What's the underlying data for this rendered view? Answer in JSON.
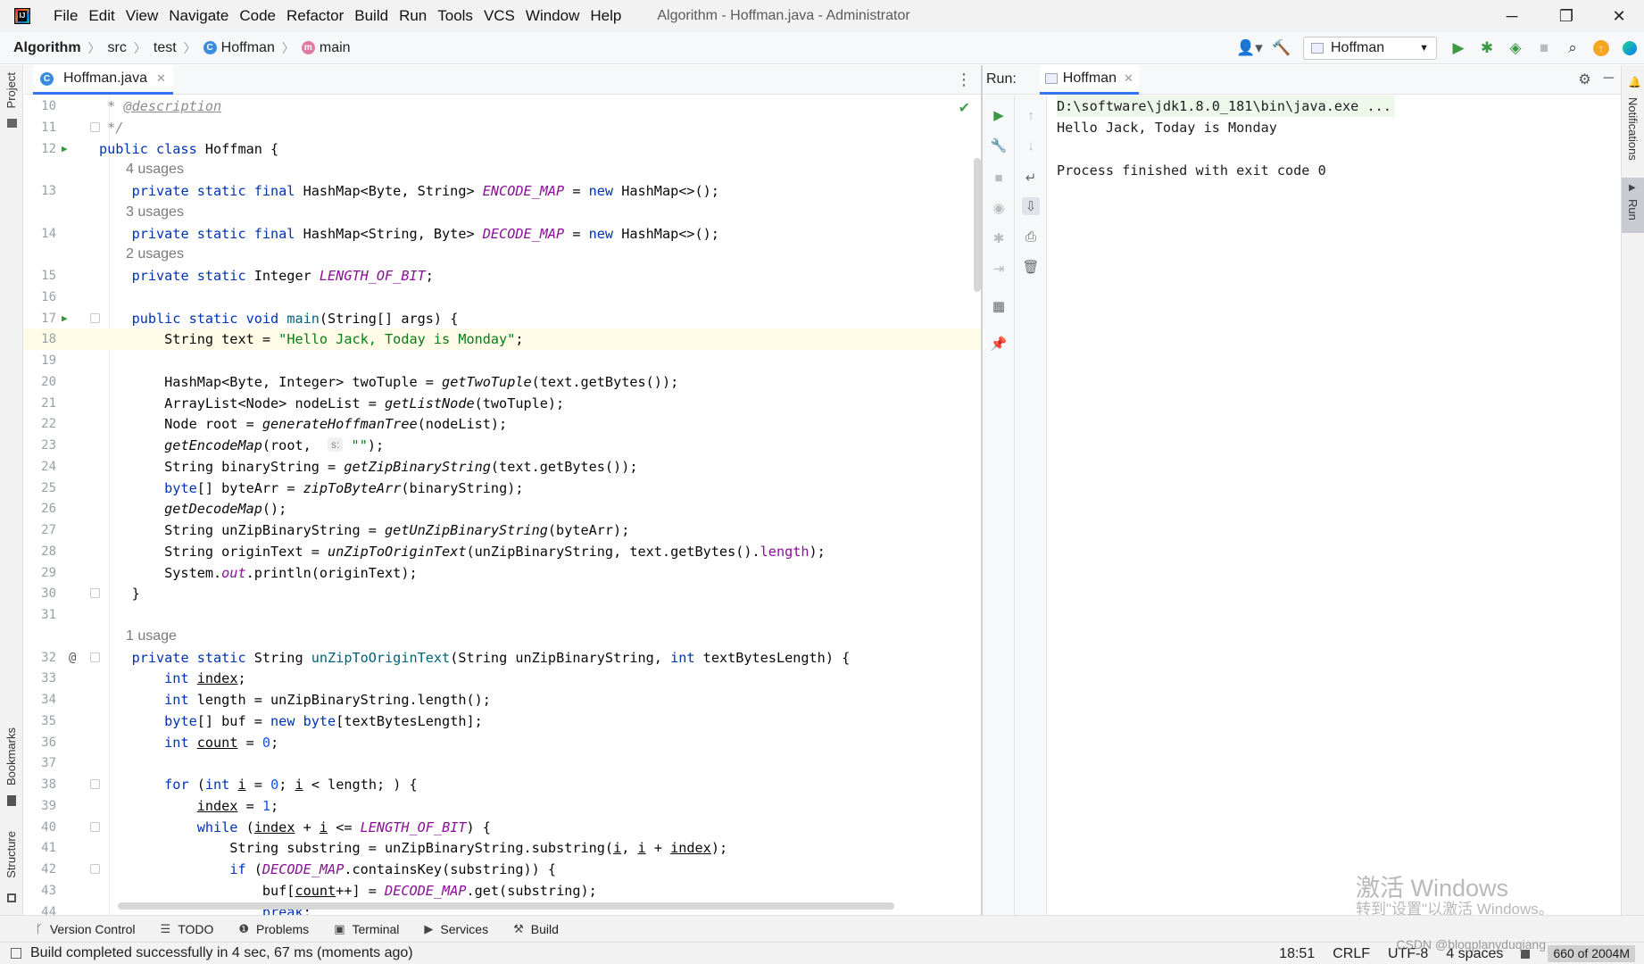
{
  "window": {
    "menu": [
      "File",
      "Edit",
      "View",
      "Navigate",
      "Code",
      "Refactor",
      "Build",
      "Run",
      "Tools",
      "VCS",
      "Window",
      "Help"
    ],
    "title": "Algorithm - Hoffman.java - Administrator",
    "controls": {
      "minimize": "─",
      "restore": "❐",
      "close": "✕"
    }
  },
  "breadcrumb": {
    "project": "Algorithm",
    "items": [
      "src",
      "test"
    ],
    "class_name": "Hoffman",
    "method_name": "main"
  },
  "toolbar": {
    "run_config": "Hoffman"
  },
  "left_strip": {
    "project": "Project",
    "bookmarks": "Bookmarks",
    "structure": "Structure"
  },
  "right_strip": {
    "notifications": "Notifications",
    "run": "Run"
  },
  "editor": {
    "tab": "Hoffman.java",
    "lines": [
      {
        "n": "10",
        "html": "<span class=\"com\"> * </span><span class=\"ann\">@description</span>"
      },
      {
        "n": "11",
        "html": "<span class=\"com\"> */</span>"
      },
      {
        "n": "12",
        "html": "<span class=\"kw\">public class</span> Hoffman {"
      },
      {
        "hint": "4 usages"
      },
      {
        "n": "13",
        "html": "    <span class=\"kw\">private static final</span> HashMap&lt;Byte, String&gt; <span class=\"fld\">ENCODE_MAP</span> = <span class=\"kw\">new</span> HashMap&lt;&gt;();"
      },
      {
        "hint": "3 usages"
      },
      {
        "n": "14",
        "html": "    <span class=\"kw\">private static final</span> HashMap&lt;String, Byte&gt; <span class=\"fld\">DECODE_MAP</span> = <span class=\"kw\">new</span> HashMap&lt;&gt;();"
      },
      {
        "hint": "2 usages"
      },
      {
        "n": "15",
        "html": "    <span class=\"kw\">private static</span> Integer <span class=\"fld\">LENGTH_OF_BIT</span>;"
      },
      {
        "n": "16",
        "html": ""
      },
      {
        "n": "17",
        "html": "    <span class=\"kw\">public static void</span> <span class=\"fn\">main</span>(String[] args) {"
      },
      {
        "n": "18",
        "html": "        String text = <span class=\"st\">\"Hello Jack, Today is Monday\"</span>;"
      },
      {
        "n": "19",
        "html": ""
      },
      {
        "n": "20",
        "html": "        HashMap&lt;Byte, Integer&gt; twoTuple = <span class=\"smc\">getTwoTuple</span>(text.getBytes());"
      },
      {
        "n": "21",
        "html": "        ArrayList&lt;Node&gt; nodeList = <span class=\"smc\">getListNode</span>(twoTuple);"
      },
      {
        "n": "22",
        "html": "        Node root = <span class=\"smc\">generateHoffmanTree</span>(nodeList);"
      },
      {
        "n": "23",
        "html": "        <span class=\"smc\">getEncodeMap</span>(root,  <span class=\"inlay\">s:</span> <span class=\"st\">\"\"</span>);"
      },
      {
        "n": "24",
        "html": "        String binaryString = <span class=\"smc\">getZipBinaryString</span>(text.getBytes());"
      },
      {
        "n": "25",
        "html": "        <span class=\"kw\">byte</span>[] byteArr = <span class=\"smc\">zipToByteArr</span>(binaryString);"
      },
      {
        "n": "26",
        "html": "        <span class=\"smc\">getDecodeMap</span>();"
      },
      {
        "n": "27",
        "html": "        String unZipBinaryString = <span class=\"smc\">getUnZipBinaryString</span>(byteArr);"
      },
      {
        "n": "28",
        "html": "        String originText = <span class=\"smc\">unZipToOriginText</span>(unZipBinaryString, text.getBytes().<span class=\"fld\" style=\"font-style:normal\">length</span>);"
      },
      {
        "n": "29",
        "html": "        System.<span class=\"fld\">out</span>.println(originText);"
      },
      {
        "n": "30",
        "html": "    }"
      },
      {
        "n": "31",
        "html": ""
      },
      {
        "hint": "1 usage"
      },
      {
        "n": "32",
        "html": "    <span class=\"kw\">private static</span> String <span class=\"fn\">unZipToOriginText</span>(String unZipBinaryString, <span class=\"kw\">int</span> textBytesLength) {"
      },
      {
        "n": "33",
        "html": "        <span class=\"kw\">int</span> <span class=\"ul\">index</span>;"
      },
      {
        "n": "34",
        "html": "        <span class=\"kw\">int</span> length = unZipBinaryString.length();"
      },
      {
        "n": "35",
        "html": "        <span class=\"kw\">byte</span>[] buf = <span class=\"kw\">new byte</span>[textBytesLength];"
      },
      {
        "n": "36",
        "html": "        <span class=\"kw\">int</span> <span class=\"ul\">count</span> = <span class=\"num\">0</span>;"
      },
      {
        "n": "37",
        "html": ""
      },
      {
        "n": "38",
        "html": "        <span class=\"kw\">for</span> (<span class=\"kw\">int</span> <span class=\"ul\">i</span> = <span class=\"num\">0</span>; <span class=\"ul\">i</span> &lt; length; ) {"
      },
      {
        "n": "39",
        "html": "            <span class=\"ul\">index</span> = <span class=\"num\">1</span>;"
      },
      {
        "n": "40",
        "html": "            <span class=\"kw\">while</span> (<span class=\"ul\">index</span> + <span class=\"ul\">i</span> &lt;= <span class=\"fld\">LENGTH_OF_BIT</span>) {"
      },
      {
        "n": "41",
        "html": "                String substring = unZipBinaryString.substring(<span class=\"ul\">i</span>, <span class=\"ul\">i</span> + <span class=\"ul\">index</span>);"
      },
      {
        "n": "42",
        "html": "                <span class=\"kw\">if</span> (<span class=\"fld\">DECODE_MAP</span>.containsKey(substring)) {"
      },
      {
        "n": "43",
        "html": "                    buf[<span class=\"ul\">count</span>++] = <span class=\"fld\">DECODE_MAP</span>.get(substring);"
      },
      {
        "n": "44",
        "html": "                    <span class=\"kw\">break</span>;"
      }
    ]
  },
  "run_panel": {
    "title": "Run:",
    "tab": "Hoffman",
    "output": [
      "D:\\software\\jdk1.8.0_181\\bin\\java.exe ...",
      "Hello Jack, Today is Monday",
      "",
      "Process finished with exit code 0"
    ]
  },
  "watermark": {
    "line1": "激活 Windows",
    "line2": "转到\"设置\"以激活 Windows。"
  },
  "bottom_tools": [
    "Version Control",
    "TODO",
    "Problems",
    "Terminal",
    "Services",
    "Build"
  ],
  "status": {
    "message": "Build completed successfully in 4 sec, 67 ms (moments ago)",
    "position": "18:51",
    "line_sep": "CRLF",
    "encoding": "UTF-8",
    "indent": "4 spaces",
    "memory": "660 of 2004M",
    "csdn": "CSDN @blogplanyduqiang"
  }
}
